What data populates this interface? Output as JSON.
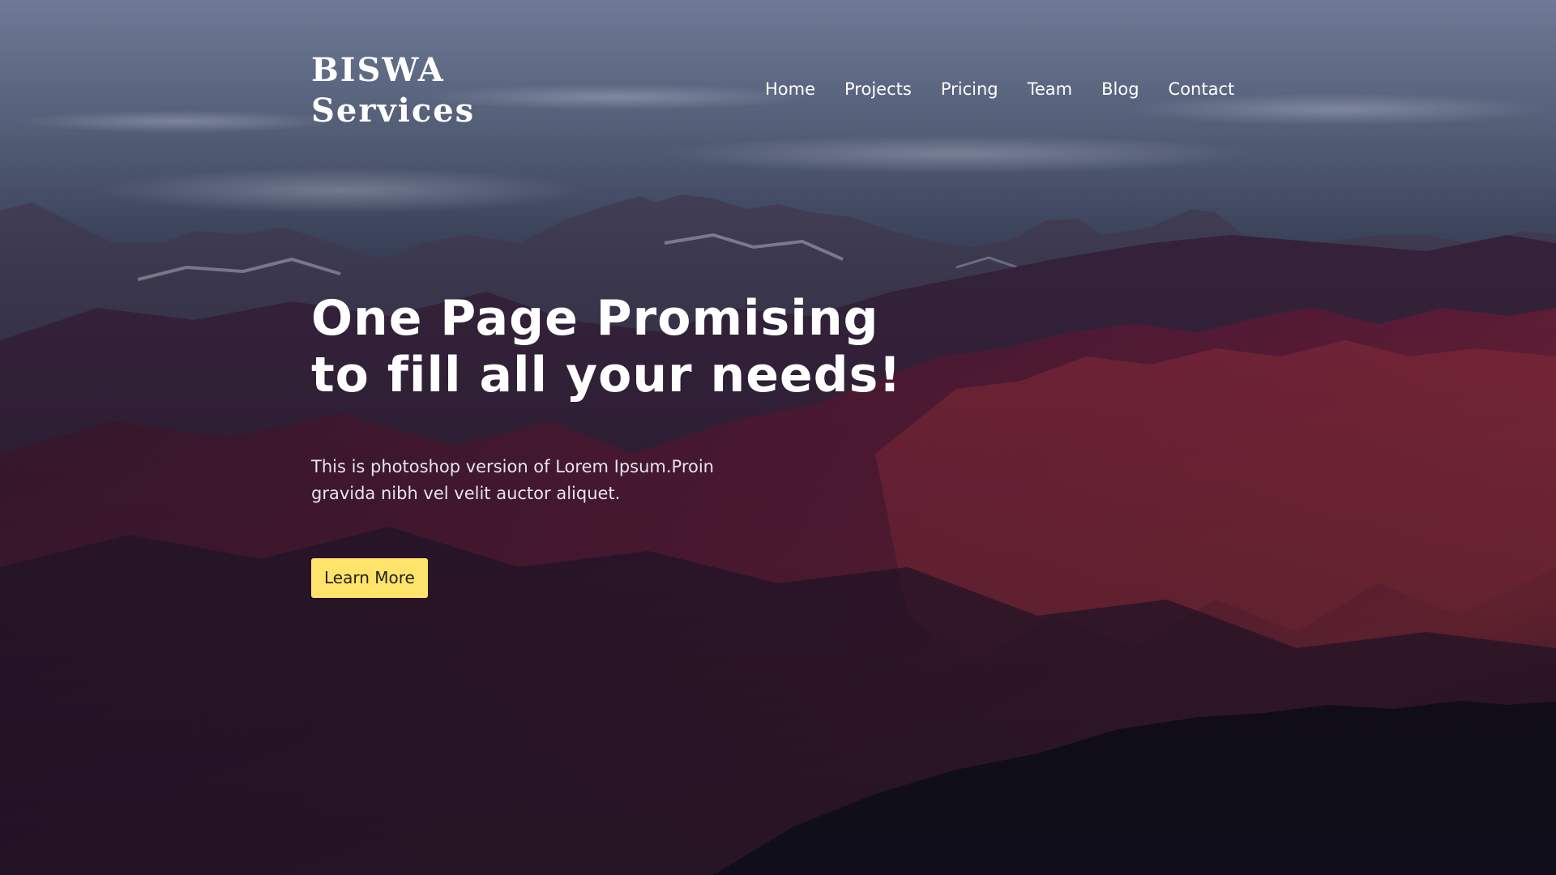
{
  "brand": {
    "line1": "BISWA",
    "line2": "Services"
  },
  "nav": {
    "items": [
      {
        "label": "Home"
      },
      {
        "label": "Projects"
      },
      {
        "label": "Pricing"
      },
      {
        "label": "Team"
      },
      {
        "label": "Blog"
      },
      {
        "label": "Contact"
      }
    ]
  },
  "hero": {
    "headline_line1": "One Page Promising",
    "headline_line2": "to fill all your needs!",
    "subtext": "This is photoshop version of Lorem Ipsum.Proin gravida nibh vel velit auctor aliquet.",
    "cta_label": "Learn More"
  },
  "colors": {
    "cta_background": "#ffe36a",
    "text": "#ffffff",
    "sky": "#5a6682",
    "mountain_red": "#8c2a45"
  }
}
